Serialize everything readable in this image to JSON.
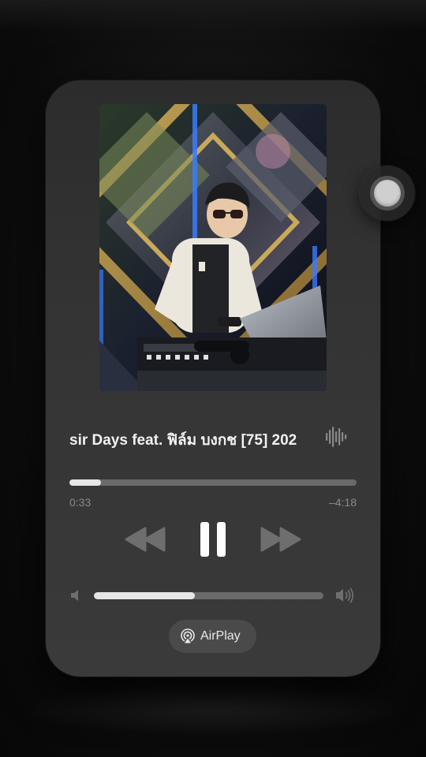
{
  "now_playing": {
    "title": "sir Days feat. ฟิล์ม บงกช [75] 202",
    "artwork_icon": "album-artwork-image"
  },
  "progress": {
    "elapsed": "0:33",
    "remaining": "–4:18",
    "fraction": 0.11
  },
  "controls": {
    "rewind_icon": "rewind-icon",
    "pause_icon": "pause-icon",
    "forward_icon": "fast-forward-icon"
  },
  "volume": {
    "level": 0.44,
    "low_icon": "speaker-low-icon",
    "high_icon": "speaker-high-icon"
  },
  "airplay": {
    "label": "AirPlay",
    "icon": "airplay-icon"
  },
  "assistive_touch": {
    "icon": "assistive-touch-icon"
  },
  "colors": {
    "card": "#343434",
    "track": "#6a6a6a",
    "fill": "#e6e6e6",
    "text": "#f2f2f2",
    "muted": "#8a8a8a"
  }
}
